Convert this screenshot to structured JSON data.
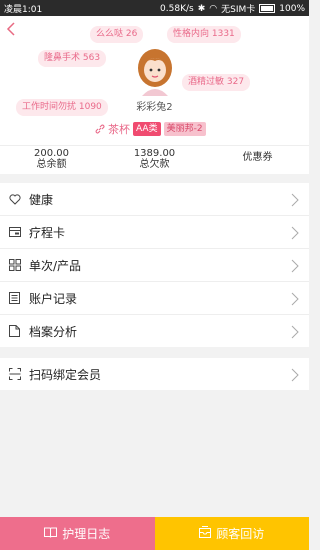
{
  "status": {
    "time": "凌晨1:01",
    "speed": "0.58K/s",
    "sim": "无SIM卡",
    "battery": "100%"
  },
  "profile": {
    "name": "彩彩兔2",
    "tags": [
      "么么哒 26",
      "性格内向 1331",
      "隆鼻手术 563",
      "酒精过敏 327",
      "工作时间勿扰 1090"
    ],
    "link_text": "茶杯",
    "badge_level": "AA类",
    "badge_group": "美丽邦-2"
  },
  "stats": {
    "balance_value": "200.00",
    "balance_label": "总余额",
    "debt_value": "1389.00",
    "debt_label": "总欠款",
    "coupon_label": "优惠券"
  },
  "menu": {
    "health": "健康",
    "course_card": "疗程卡",
    "products": "单次/产品",
    "account_records": "账户记录",
    "file_analysis": "档案分析",
    "scan_bind": "扫码绑定会员"
  },
  "footer": {
    "care_log": "护理日志",
    "customer_visit": "顾客回访"
  },
  "colors": {
    "accent": "#ee6e8c",
    "yellow": "#ffc400",
    "tag_bg": "#fde8ec"
  }
}
